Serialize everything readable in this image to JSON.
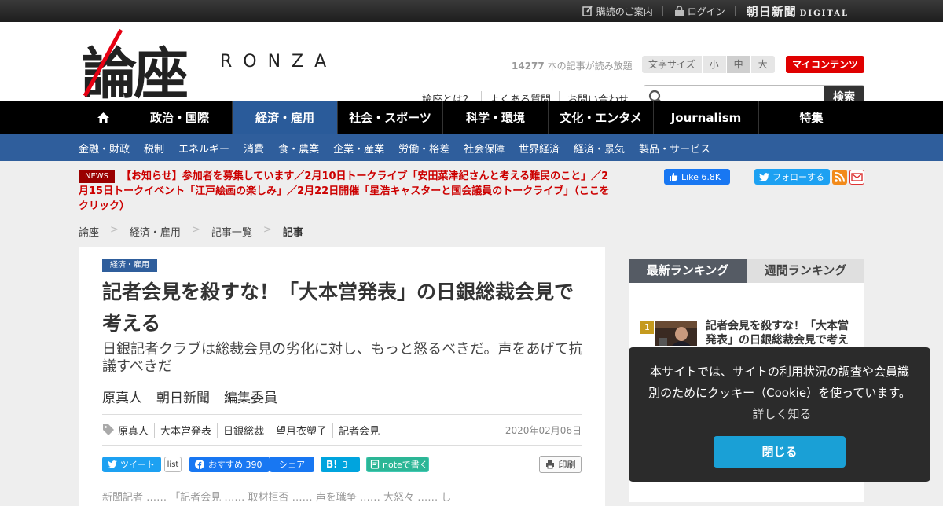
{
  "topbar": {
    "subscribe": "購読のご案内",
    "login": "ログイン",
    "brand_main": "朝日新聞",
    "brand_sub": "DIGITAL"
  },
  "header": {
    "logo_kanji": "論座",
    "logo_latin": "RONZA",
    "read_count_number": "14277",
    "read_count_text": "本の記事が読み放題",
    "font_size_label": "文字サイズ",
    "font_sizes": [
      "小",
      "中",
      "大"
    ],
    "font_size_selected": "中",
    "my_contents": "マイコンテンツ",
    "links": [
      "論座とは？",
      "よくある質問",
      "お問い合わせ"
    ],
    "search_placeholder": "",
    "search_button": "検索"
  },
  "gnav": {
    "items": [
      "政治・国際",
      "経済・雇用",
      "社会・スポーツ",
      "科学・環境",
      "文化・エンタメ",
      "Journalism",
      "特集"
    ],
    "active": "経済・雇用"
  },
  "subnav": {
    "items": [
      "金融・財政",
      "税制",
      "エネルギー",
      "消費",
      "食・農業",
      "企業・産業",
      "労働・格差",
      "社会保障",
      "世界経済",
      "経済・景気",
      "製品・サービス"
    ]
  },
  "news": {
    "badge": "NEWS",
    "text": "【お知らせ】参加者を募集しています／2月10日トークライブ「安田菜津紀さんと考える難民のこと」／2月15日トークイベント「江戸絵画の楽しみ」／2月22日開催「星浩キャスターと国会議員のトークライブ」（ここをクリック）"
  },
  "social_top": {
    "fb_like": "Like 6.8K",
    "tw_follow": "フォローする"
  },
  "breadcrumb": [
    "論座",
    "経済・雇用",
    "記事一覧",
    "記事"
  ],
  "article": {
    "category": "経済・雇用",
    "title": "記者会見を殺すな！「大本営発表」の日銀総裁会見で考える",
    "subtitle": "日銀記者クラブは総裁会見の劣化に対し、もっと怒るべきだ。声をあげて抗議すべきだ",
    "author_name": "原真人",
    "author_org": "朝日新聞",
    "author_role": "編集委員",
    "tags": [
      "原真人",
      "大本営発表",
      "日銀総裁",
      "望月衣塑子",
      "記者会見"
    ],
    "date": "2020年02月06日",
    "share": {
      "tweet": "ツイート",
      "list": "list",
      "fb_recommend": "おすすめ 390",
      "fb_share": "シェア",
      "hatena": "3",
      "note": "noteで書く",
      "print": "印刷"
    },
    "body_fragment": "新聞記者 …… 「記者会見 …… 取材拒否 …… 声を職争 …… 大怒々 …… し"
  },
  "ranking": {
    "tabs": [
      "最新ランキング",
      "週間ランキング"
    ],
    "items": [
      {
        "rank": "1",
        "title": "記者会見を殺すな！「大本営発表」の日銀総裁会見で考える"
      }
    ]
  },
  "cookie": {
    "message": "本サイトでは、サイトの利用状況の調査や会員識別のためにクッキー（Cookie）を使っています。",
    "more": "詳しく知る",
    "close": "閉じる"
  }
}
